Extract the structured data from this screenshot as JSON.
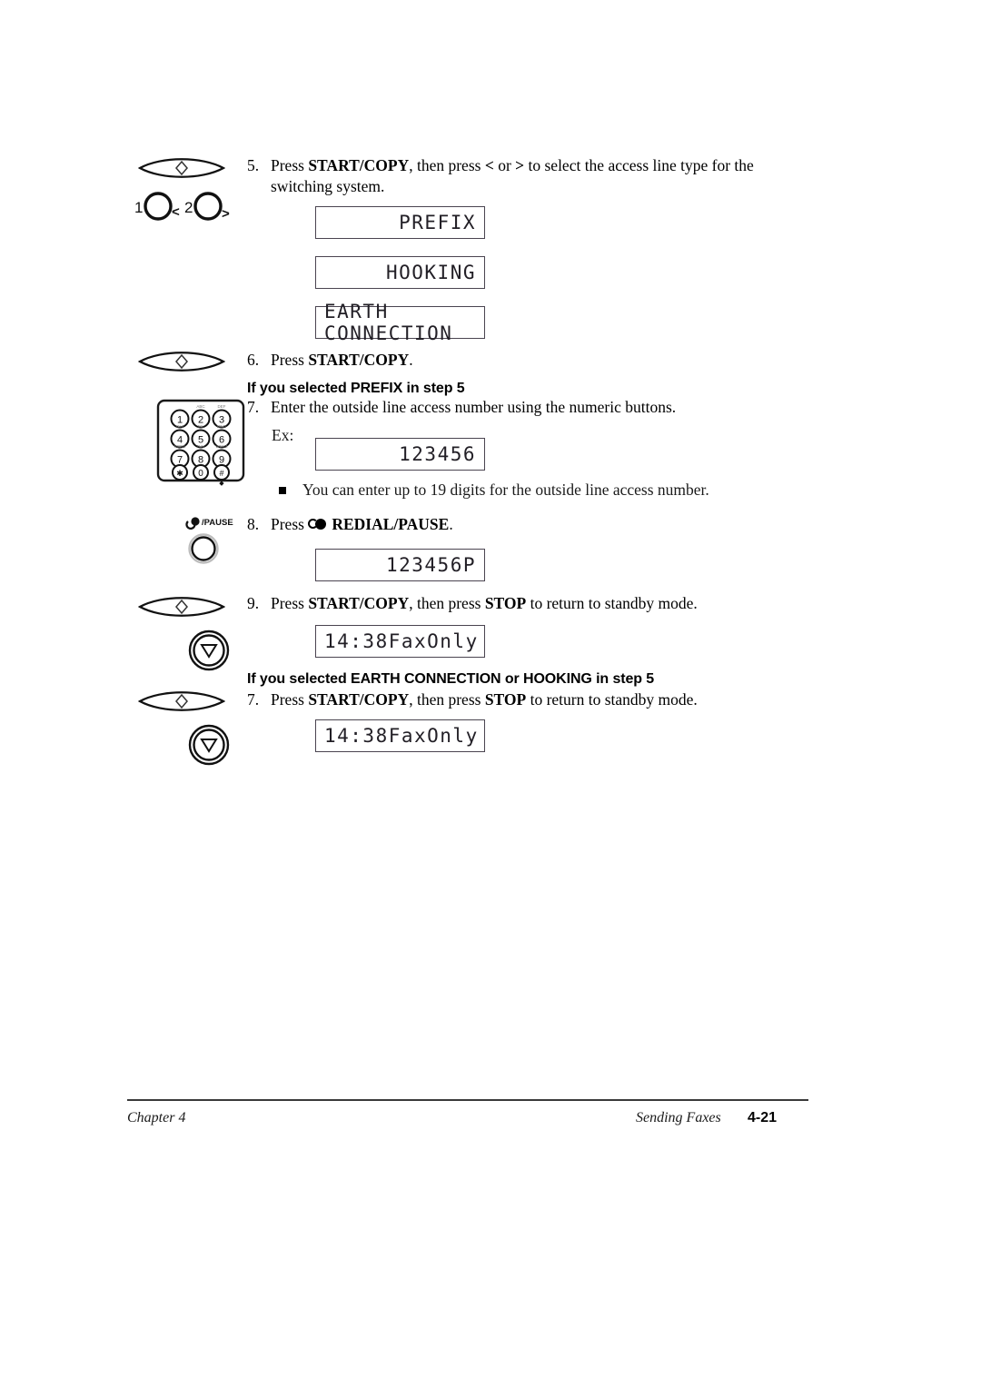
{
  "document": {
    "footer": {
      "chapter": "Chapter 4",
      "section": "Sending Faxes",
      "page_number": "4-21"
    }
  },
  "steps": [
    {
      "number": "5.",
      "text_parts": [
        "Press ",
        "START/COPY",
        ", then press ",
        "<",
        " or ",
        ">",
        " to select the access line type for the switching system."
      ],
      "plain": "Press START/COPY, then press < or > to select the access line type for the switching system.",
      "icon": "start-copy-button-icon"
    },
    {
      "number": "6.",
      "plain": "Press START/COPY.",
      "icon": "start-copy-button-icon"
    },
    {
      "number": "7.",
      "plain": "Enter the outside line access number using the numeric buttons.",
      "icon": "numeric-keypad-icon"
    },
    {
      "number": "8.",
      "plain": "Press REDIAL/PAUSE.",
      "icon": "redial-pause-button-icon"
    },
    {
      "number": "9.",
      "plain": "Press START/COPY, then press STOP to return to standby mode.",
      "icon": "start-copy-button-icon"
    },
    {
      "number": "7.",
      "plain": "Press START/COPY, then press STOP to return to standby mode.",
      "icon": "start-copy-button-icon"
    }
  ],
  "text": {
    "step5_a": "Press ",
    "step5_b": "START/COPY",
    "step5_c": ", then press ",
    "step5_d": "<",
    "step5_e": " or ",
    "step5_f": ">",
    "step5_g": " to select the access line type for the switching system.",
    "step5_num": "5.",
    "step6_num": "6.",
    "step6_a": "Press ",
    "step6_b": "START/COPY",
    "step6_c": ".",
    "heading_prefix": "If you selected PREFIX in step 5",
    "step7_num": "7.",
    "step7_text": "Enter the outside line access number using the numeric buttons.",
    "ex_label": "Ex:",
    "note_text": "You can enter up to 19 digits for the outside line access number.",
    "step8_num": "8.",
    "step8_a": "Press ",
    "step8_b": "REDIAL/PAUSE",
    "step8_c": ".",
    "step9_num": "9.",
    "step9_a": "Press ",
    "step9_b": "START/COPY",
    "step9_c": ", then press ",
    "step9_d": "STOP",
    "step9_e": " to return to standby mode.",
    "heading_earth": "If you selected EARTH CONNECTION or HOOKING in step 5",
    "step7b_num": "7.",
    "step7b_a": "Press ",
    "step7b_b": "START/COPY",
    "step7b_c": ", then press ",
    "step7b_d": "STOP",
    "step7b_e": " to return to standby mode."
  },
  "displays": [
    {
      "id": "prefix",
      "value": "PREFIX",
      "align": "right"
    },
    {
      "id": "hooking",
      "value": "HOOKING",
      "align": "right"
    },
    {
      "id": "earth_connection",
      "value": "EARTH CONNECTION",
      "align": "fill"
    },
    {
      "id": "number_entry",
      "value": "123456",
      "align": "right"
    },
    {
      "id": "number_pause",
      "value": "123456P",
      "align": "right"
    },
    {
      "id": "standby_1",
      "left": "14:38",
      "right": "FaxOnly",
      "align": "split"
    },
    {
      "id": "standby_2",
      "left": "14:38",
      "right": "FaxOnly",
      "align": "split"
    }
  ],
  "icons": {
    "start_copy": {
      "name": "start-copy-button-icon",
      "label": ""
    },
    "arrow_keys": {
      "name": "arrow-keys-icon",
      "key1": "1",
      "lt": "<",
      "key2": "2",
      "gt": ">"
    },
    "keypad": {
      "name": "numeric-keypad-icon",
      "rows": [
        [
          {
            "key": "1",
            "sub": ""
          },
          {
            "key": "2",
            "sub": "ABC"
          },
          {
            "key": "3",
            "sub": "DEF"
          }
        ],
        [
          {
            "key": "4",
            "sub": "GHI"
          },
          {
            "key": "5",
            "sub": "JKL"
          },
          {
            "key": "6",
            "sub": "MNO"
          }
        ],
        [
          {
            "key": "7",
            "sub": "PQRS"
          },
          {
            "key": "8",
            "sub": "TUV"
          },
          {
            "key": "9",
            "sub": "WXYZ"
          }
        ],
        [
          {
            "key": "∗",
            "sub": ""
          },
          {
            "key": "0",
            "sub": ""
          },
          {
            "key": "#",
            "sub": ""
          }
        ]
      ]
    },
    "redial_pause": {
      "name": "redial-pause-button-icon",
      "label": "/PAUSE"
    },
    "stop": {
      "name": "stop-button-icon"
    }
  },
  "colors": {
    "ink": "#1a1a1a",
    "lcd_border": "#4a4450",
    "rule": "#3a3a3a"
  }
}
